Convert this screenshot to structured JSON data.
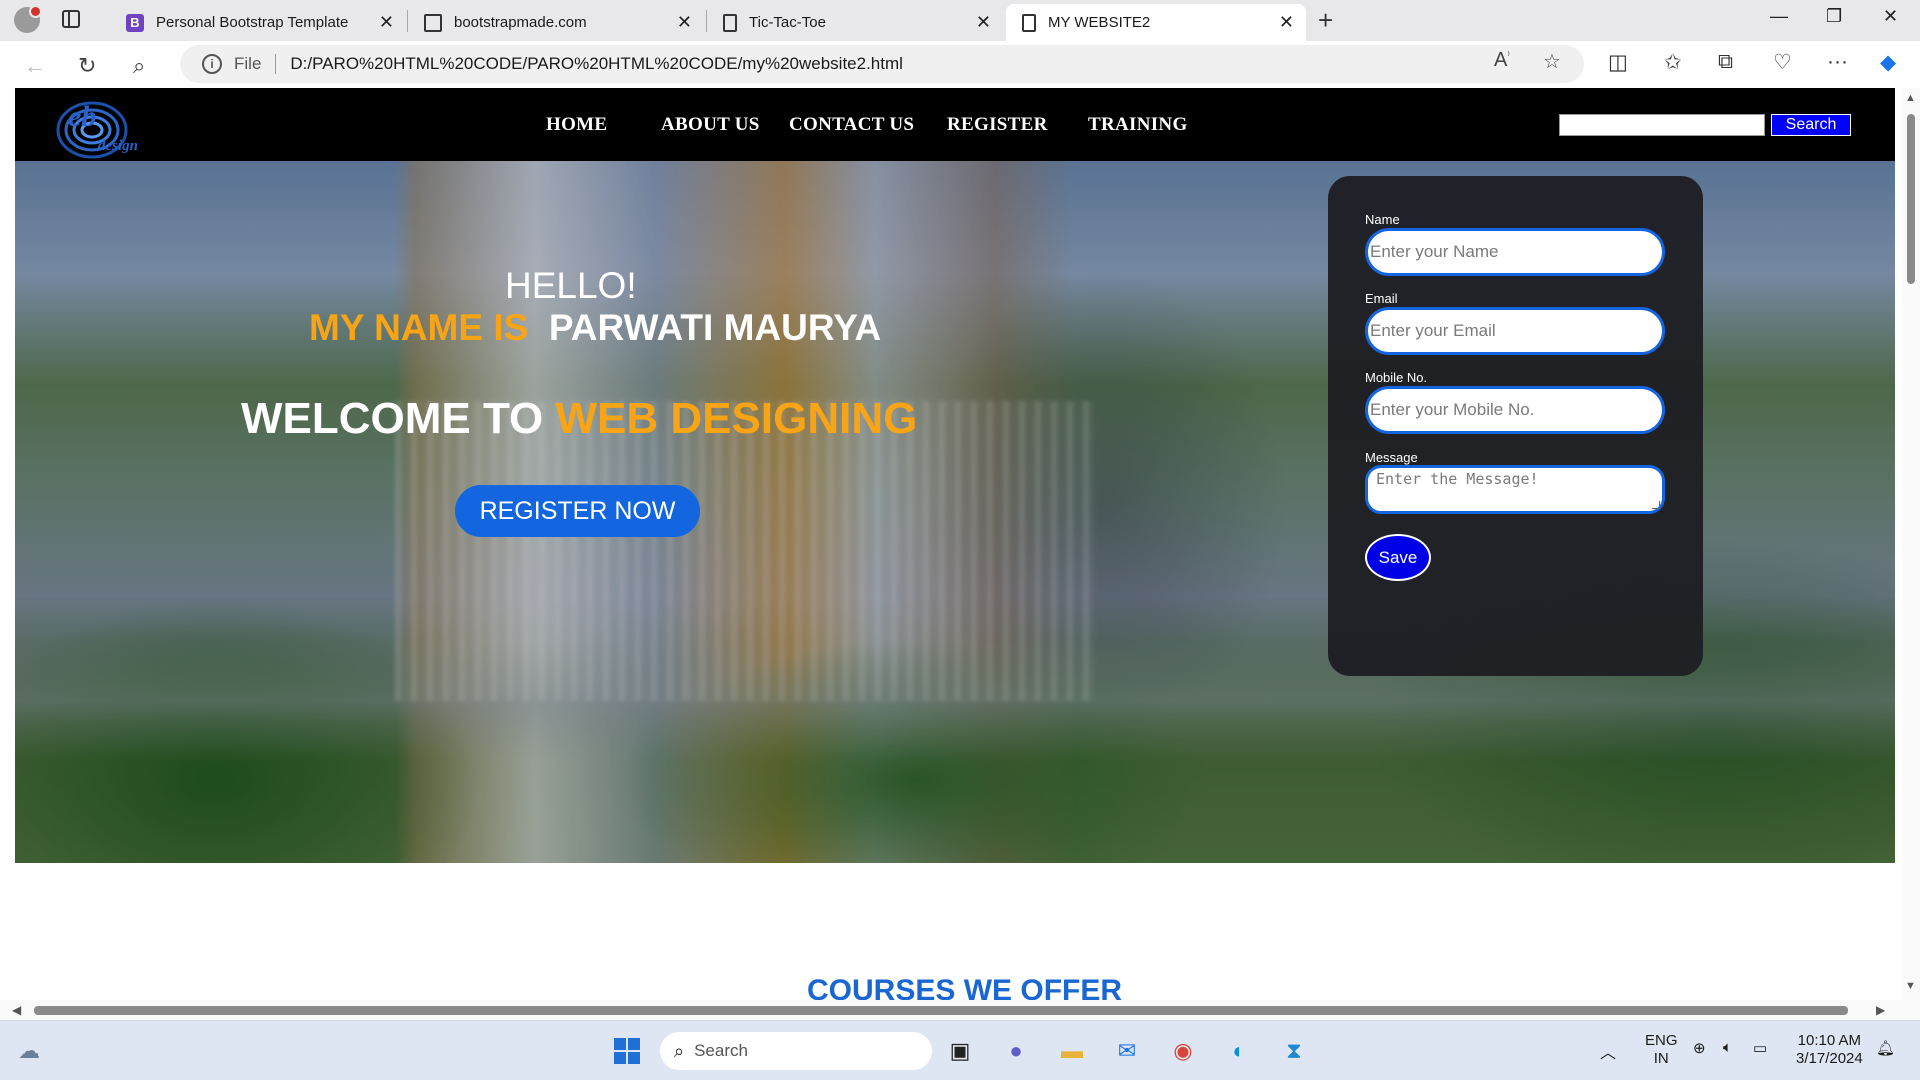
{
  "browser": {
    "tabs": [
      {
        "title": "Personal Bootstrap Template",
        "favicon": "bootstrap-icon"
      },
      {
        "title": "bootstrapmade.com",
        "favicon": "page-icon"
      },
      {
        "title": "Tic-Tac-Toe",
        "favicon": "page-icon"
      },
      {
        "title": "MY WEBSITE2",
        "favicon": "page-icon",
        "active": true
      }
    ],
    "address": {
      "scheme_label": "File",
      "url": "D:/PARO%20HTML%20CODE/PARO%20HTML%20CODE/my%20website2.html"
    }
  },
  "site": {
    "nav": {
      "items": [
        "HOME",
        "ABOUT US",
        "CONTACT US",
        "REGISTER",
        "TRAINING"
      ],
      "search_button": "Search",
      "search_value": ""
    },
    "hero": {
      "hello": "HELLO!",
      "name_prefix": "MY NAME IS",
      "name": "PARWATI MAURYA",
      "welcome_prefix": "WELCOME TO",
      "welcome_highlight": "WEB DESIGNING",
      "register_button": "REGISTER NOW"
    },
    "form": {
      "name_label": "Name",
      "name_placeholder": "Enter your Name",
      "email_label": "Email",
      "email_placeholder": "Enter your Email",
      "mobile_label": "Mobile No.",
      "mobile_placeholder": "Enter your Mobile No.",
      "message_label": "Message",
      "message_placeholder": "Enter the Message!",
      "save_button": "Save"
    },
    "section_heading": "COURSES WE OFFER"
  },
  "taskbar": {
    "search_placeholder": "Search",
    "language": "ENG",
    "region": "IN",
    "time": "10:10 AM",
    "date": "3/17/2024"
  },
  "colors": {
    "accent_orange": "#f7a516",
    "button_blue": "#1366e0",
    "search_blue": "#0000ff",
    "heading_blue": "#1a67d2"
  }
}
